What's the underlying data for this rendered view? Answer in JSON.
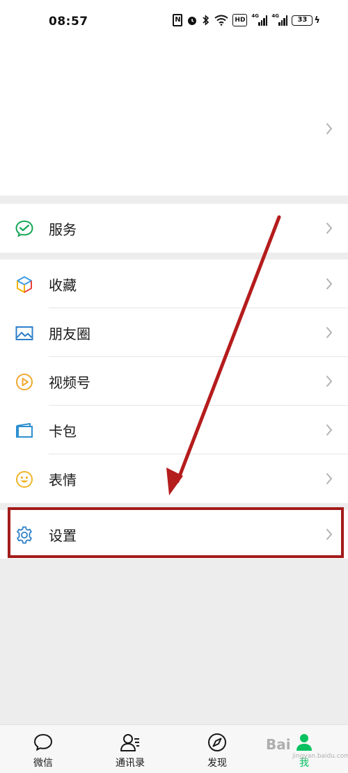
{
  "status_bar": {
    "time": "08:57",
    "signal1_label": "4G",
    "signal2_label": "4G",
    "battery": "33",
    "hd": "HD"
  },
  "menu": {
    "service": {
      "label": "服务",
      "icon": "wechat-pay-icon"
    },
    "items": [
      {
        "label": "收藏",
        "icon": "cube-icon"
      },
      {
        "label": "朋友圈",
        "icon": "image-icon"
      },
      {
        "label": "视频号",
        "icon": "play-icon"
      },
      {
        "label": "卡包",
        "icon": "card-icon"
      },
      {
        "label": "表情",
        "icon": "smile-icon"
      }
    ],
    "settings": {
      "label": "设置",
      "icon": "gear-icon"
    }
  },
  "annotation": {
    "arrow_color": "#b51c1c",
    "box_color": "#a31b1b"
  },
  "tabbar": {
    "tabs": [
      {
        "label": "微信",
        "icon": "chat-bubble-icon"
      },
      {
        "label": "通讯录",
        "icon": "contacts-icon"
      },
      {
        "label": "发现",
        "icon": "compass-icon"
      },
      {
        "label": "我",
        "icon": "person-icon",
        "active": true
      }
    ],
    "active_color": "#07c160"
  },
  "watermark": {
    "text": "Bai",
    "sub": "jingyan.baidu.com"
  }
}
